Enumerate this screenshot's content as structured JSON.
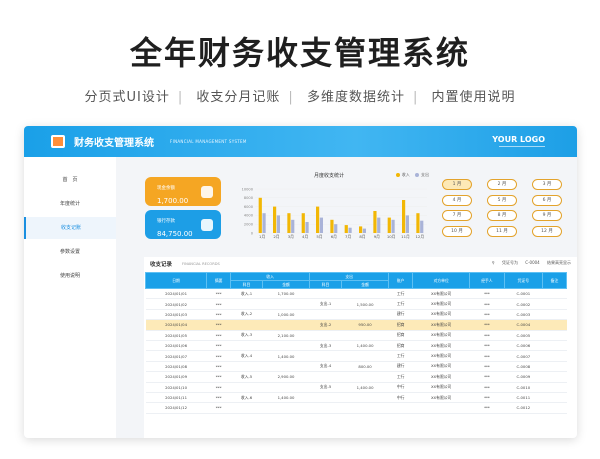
{
  "hero": {
    "title": "全年财务收支管理系统",
    "features": [
      "分页式UI设计",
      "收支分月记账",
      "多维度数据统计",
      "内置使用说明"
    ]
  },
  "header": {
    "title": "财务收支管理系统",
    "subtitle": "FINANCIAL MANAGEMENT SYSTEM",
    "logo_text": "YOUR LOGO"
  },
  "sidebar": {
    "items": [
      {
        "label": "首　页",
        "active": false
      },
      {
        "label": "年度统计",
        "active": false
      },
      {
        "label": "收支记账",
        "active": true
      },
      {
        "label": "参数设置",
        "active": false
      },
      {
        "label": "使用说明",
        "active": false
      }
    ]
  },
  "cards": {
    "current_balance": {
      "label": "现金余额",
      "value": "1,700.00"
    },
    "bank_balance": {
      "label": "银行存款",
      "value": "84,750.00"
    }
  },
  "colors": {
    "accent": "#1aa0e8",
    "income": "#f2b705",
    "expense": "#a9b3d8",
    "card_orange": "#f5a623",
    "card_blue": "#1d9ee6",
    "highlight": "#fdeab8"
  },
  "chart_data": {
    "type": "bar",
    "title": "月度收支统计",
    "categories": [
      "1月",
      "2月",
      "3月",
      "4月",
      "5月",
      "6月",
      "7月",
      "8月",
      "9月",
      "10月",
      "11月",
      "12月"
    ],
    "series": [
      {
        "name": "收入",
        "values": [
          8000,
          6000,
          4500,
          4500,
          6000,
          3000,
          1800,
          1500,
          5000,
          3500,
          7500,
          4500
        ]
      },
      {
        "name": "支出",
        "values": [
          4500,
          4000,
          3000,
          2500,
          3500,
          2000,
          1200,
          1000,
          3500,
          3000,
          4000,
          2800
        ]
      }
    ],
    "ylim": [
      0,
      10000
    ],
    "yticks": [
      "10000",
      "8000",
      "6000",
      "4000",
      "2000",
      "0"
    ],
    "legend_position": "top-right",
    "grid": true
  },
  "months": {
    "items": [
      "1 月",
      "2 月",
      "3 月",
      "4 月",
      "5 月",
      "6 月",
      "7 月",
      "8 月",
      "9 月",
      "10 月",
      "11 月",
      "12 月"
    ],
    "selected": 0
  },
  "records": {
    "title": "收支记录",
    "subtitle": "FINANCIAL RECORDS",
    "search_label": "凭证号为",
    "search_value": "C-0004",
    "search_hint": "结果高亮显示",
    "group_headers": {
      "income": "收入",
      "expense": "支出"
    },
    "columns": [
      "日期",
      "摘要",
      "科目",
      "金额",
      "科目",
      "金额",
      "账户",
      "对方单位",
      "经手人",
      "凭证号",
      "备注"
    ],
    "rows": [
      [
        "2024/01/01",
        "***",
        "收入-1",
        "1,700.00",
        "",
        "",
        "工行",
        "XX有限公司",
        "***",
        "C-0001",
        ""
      ],
      [
        "2024/01/02",
        "***",
        "",
        "",
        "支出-1",
        "1,500.00",
        "工行",
        "XX有限公司",
        "***",
        "C-0002",
        ""
      ],
      [
        "2024/01/03",
        "***",
        "收入-2",
        "1,000.00",
        "",
        "",
        "建行",
        "XX有限公司",
        "***",
        "C-0003",
        ""
      ],
      [
        "2024/01/04",
        "***",
        "",
        "",
        "支出-2",
        "950.00",
        "招商",
        "XX有限公司",
        "***",
        "C-0004",
        ""
      ],
      [
        "2024/01/05",
        "***",
        "收入-3",
        "2,100.00",
        "",
        "",
        "招商",
        "XX有限公司",
        "***",
        "C-0005",
        ""
      ],
      [
        "2024/01/06",
        "***",
        "",
        "",
        "支出-3",
        "1,400.00",
        "招商",
        "XX有限公司",
        "***",
        "C-0006",
        ""
      ],
      [
        "2024/01/07",
        "***",
        "收入-4",
        "1,400.00",
        "",
        "",
        "工行",
        "XX有限公司",
        "***",
        "C-0007",
        ""
      ],
      [
        "2024/01/08",
        "***",
        "",
        "",
        "支出-4",
        "800.00",
        "建行",
        "XX有限公司",
        "***",
        "C-0008",
        ""
      ],
      [
        "2024/01/09",
        "***",
        "收入-5",
        "2,900.00",
        "",
        "",
        "工行",
        "XX有限公司",
        "***",
        "C-0009",
        ""
      ],
      [
        "2024/01/10",
        "***",
        "",
        "",
        "支出-5",
        "1,400.00",
        "中行",
        "XX有限公司",
        "***",
        "C-0010",
        ""
      ],
      [
        "2024/01/11",
        "***",
        "收入-6",
        "1,400.00",
        "",
        "",
        "中行",
        "XX有限公司",
        "***",
        "C-0011",
        ""
      ],
      [
        "2024/01/12",
        "***",
        "",
        "",
        "",
        "",
        "",
        "",
        "***",
        "C-0012",
        ""
      ]
    ],
    "highlight_row": 3
  }
}
